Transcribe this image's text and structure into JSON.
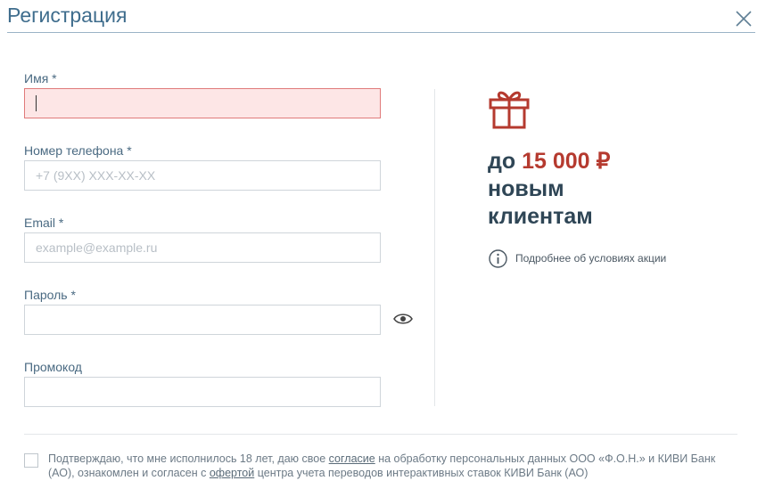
{
  "header": {
    "title": "Регистрация",
    "close_icon": "close-icon"
  },
  "form": {
    "name": {
      "label": "Имя",
      "required_mark": "*",
      "value": "",
      "placeholder": "",
      "state": "error"
    },
    "phone": {
      "label": "Номер телефона",
      "required_mark": "*",
      "value": "",
      "placeholder": "+7 (9XX) XXX-XX-XX"
    },
    "email": {
      "label": "Email",
      "required_mark": "*",
      "value": "",
      "placeholder": "example@example.ru"
    },
    "password": {
      "label": "Пароль",
      "required_mark": "*",
      "value": "",
      "placeholder": "",
      "toggle_icon": "eye-icon"
    },
    "promo": {
      "label": "Промокод",
      "value": "",
      "placeholder": ""
    }
  },
  "offer": {
    "icon": "gift-icon",
    "line1_prefix": "до",
    "line1_amount": "15 000 ₽",
    "line2": "новым",
    "line3": "клиентам",
    "info_icon": "info-icon",
    "details_link": "Подробнее об условиях акции"
  },
  "consent": {
    "part1": "Подтверждаю, что мне исполнилось 18 лет, даю свое ",
    "link1": "согласие",
    "part2": " на обработку персональных данных ООО «Ф.О.Н.» и КИВИ Банк (АО), ознакомлен и согласен с ",
    "link2": "офертой",
    "part3": " центра учета переводов интерактивных ставок КИВИ Банк (АО)"
  },
  "colors": {
    "title": "#3f6d8d",
    "accent_red": "#b53a2f",
    "offer_text": "#2f4656",
    "error_bg": "#fde6e6",
    "error_border": "#e07a7a"
  }
}
